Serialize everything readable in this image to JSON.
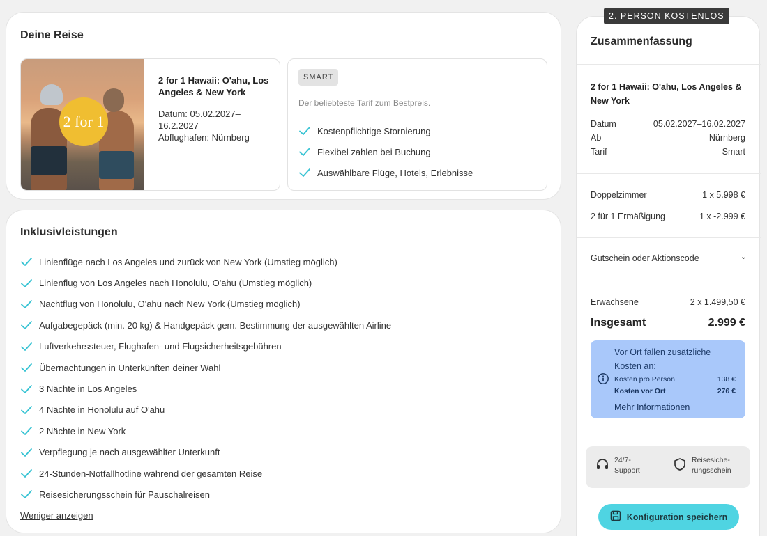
{
  "trip": {
    "title": "Deine Reise",
    "image_badge": "2 for 1",
    "name": "2 for 1 Hawaii: O'ahu, Los Angeles & New York",
    "date": "Datum: 05.02.2027–16.2.2027",
    "airport": "Abflughafen: Nürnberg"
  },
  "tariff": {
    "tag": "SMART",
    "description": "Der beliebteste Tarif zum Bestpreis.",
    "features": [
      "Kostenpflichtige Stornierung",
      "Flexibel zahlen bei Buchung",
      "Auswählbare Flüge, Hotels, Erlebnisse"
    ]
  },
  "inclusions": {
    "title": "Inklusivleistungen",
    "items": [
      "Linienflüge nach Los Angeles und zurück von New York (Umstieg möglich)",
      "Linienflug von Los Angeles nach Honolulu, O'ahu (Umstieg möglich)",
      "Nachtflug von Honolulu, O'ahu nach New York (Umstieg möglich)",
      "Aufgabegepäck (min. 20 kg) & Handgepäck gem. Bestimmung der ausgewählten Airline",
      "Luftverkehrssteuer, Flughafen- und Flugsicherheitsgebühren",
      "Übernachtungen in Unterkünften deiner Wahl",
      "3 Nächte in Los Angeles",
      "4 Nächte in Honolulu auf O'ahu",
      "2 Nächte in New York",
      "Verpflegung je nach ausgewählter Unterkunft",
      "24-Stunden-Notfallhotline während der gesamten Reise",
      "Reisesicherungsschein für Pauschalreisen"
    ],
    "less_label": "Weniger anzeigen"
  },
  "summary": {
    "badge": "2. PERSON KOSTENLOS",
    "title": "Zusammenfassung",
    "trip_name": "2 for 1 Hawaii: O'ahu, Los Angeles & New York",
    "details": [
      {
        "label": "Datum",
        "value": "05.02.2027–16.02.2027"
      },
      {
        "label": "Ab",
        "value": "Nürnberg"
      },
      {
        "label": "Tarif",
        "value": "Smart"
      }
    ],
    "prices": [
      {
        "label": "Doppelzimmer",
        "value": "1 x  5.998 €"
      },
      {
        "label": "2 für 1 Ermäßigung",
        "value": "1 x  -2.999 €"
      }
    ],
    "voucher_label": "Gutschein oder Aktionscode",
    "adults_label": "Erwachsene",
    "adults_value": "2 x 1.499,50 €",
    "total_label": "Insgesamt",
    "total_value": "2.999 €",
    "info": {
      "heading": "Vor Ort fallen zusätzliche Kosten an:",
      "per_person_label": "Kosten pro Person",
      "per_person_value": "138 €",
      "on_site_label": "Kosten vor Ort",
      "on_site_value": "276 €",
      "more_label": "Mehr Informationen"
    },
    "support_label": "24/7-Support",
    "insurance_label": "Reisesiche-rungsschein",
    "save_label": "Konfiguration speichern"
  },
  "colors": {
    "accent": "#4fd4e2",
    "check": "#36c3d3",
    "info_bg": "#a9c8fa"
  }
}
